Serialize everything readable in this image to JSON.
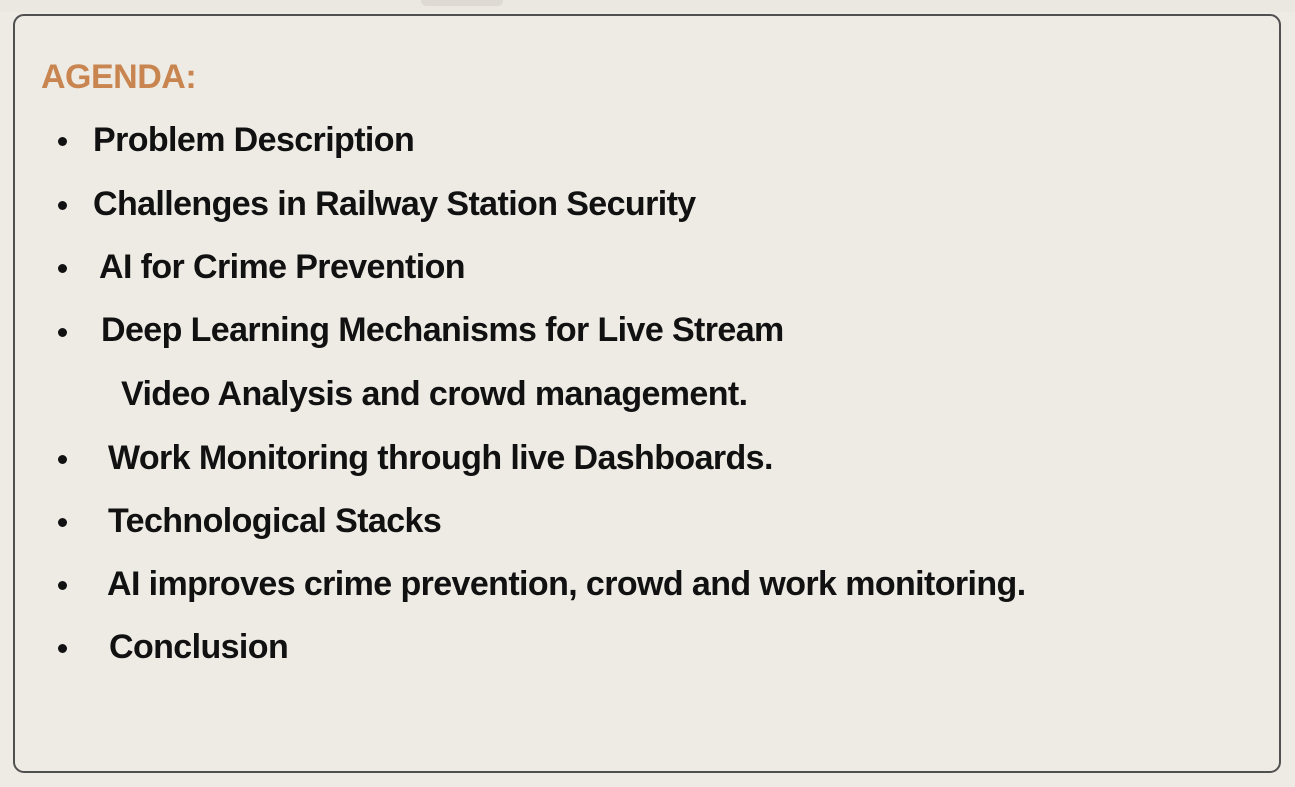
{
  "agenda": {
    "title": "AGENDA:",
    "items": [
      "Problem Description",
      "Challenges in Railway Station Security",
      "AI for Crime Prevention",
      "Deep Learning Mechanisms for Live Stream",
      "Video Analysis and crowd management.",
      "Work Monitoring through live Dashboards.",
      "Technological Stacks",
      "AI improves crime prevention, crowd and work monitoring.",
      "Conclusion"
    ]
  },
  "colors": {
    "title": "#c9854f",
    "text": "#111111",
    "background": "#eeebe5",
    "border": "#505050"
  }
}
